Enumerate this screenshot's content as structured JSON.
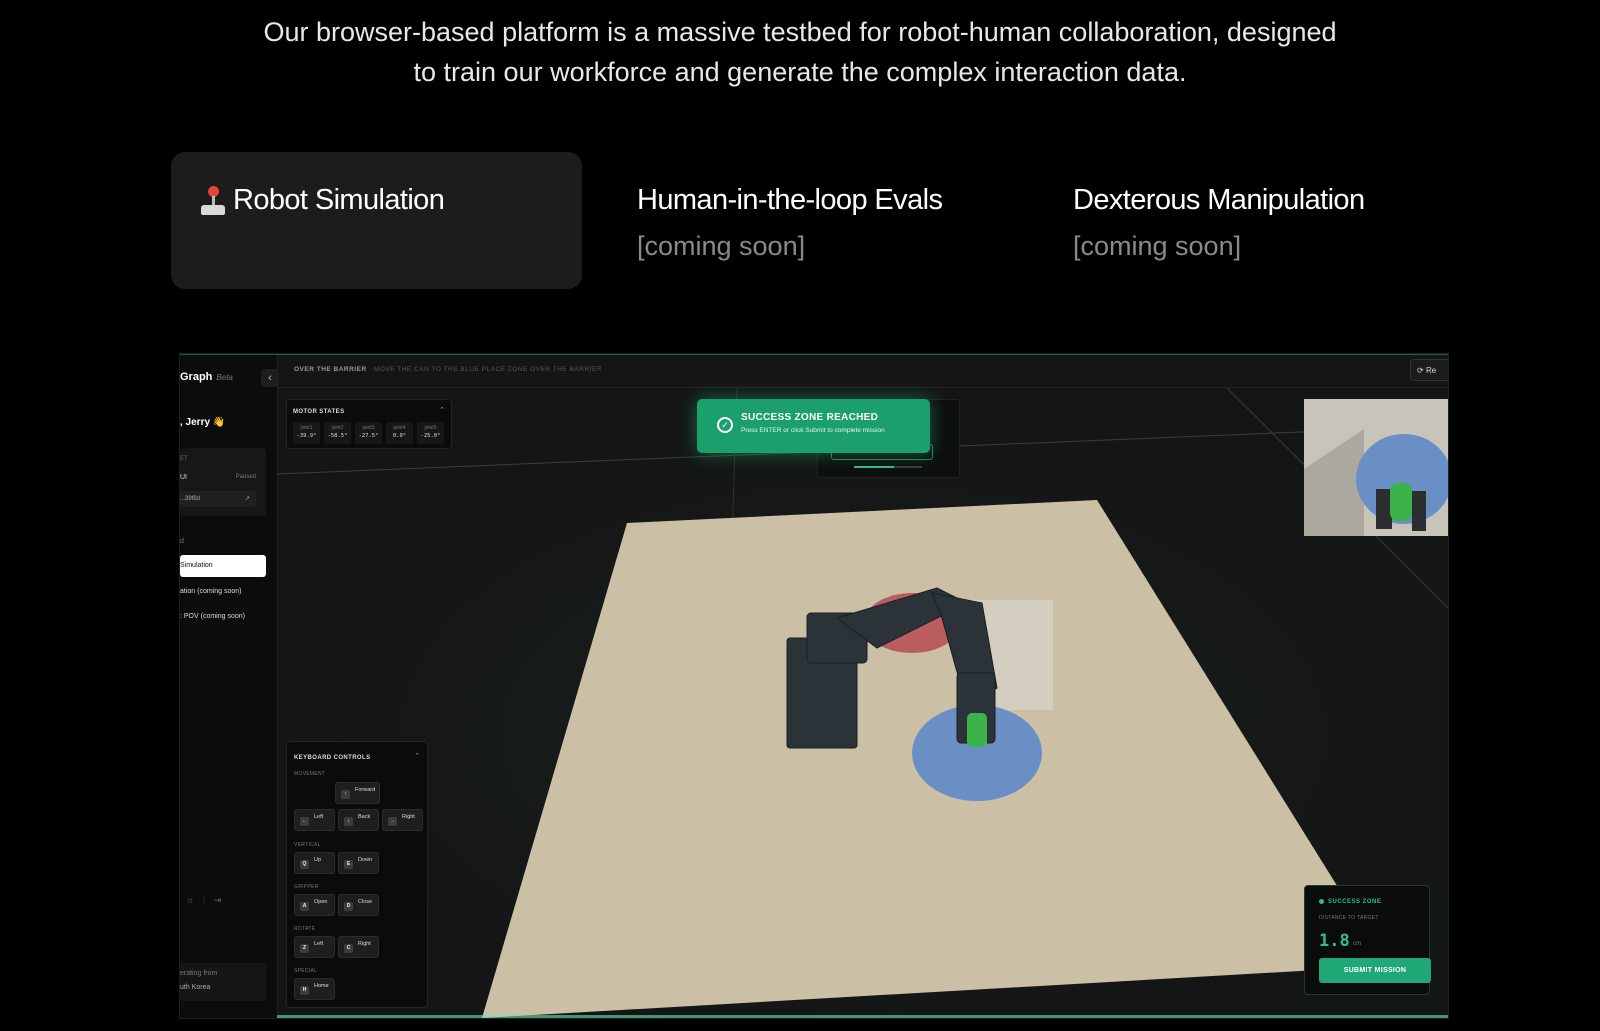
{
  "intro": {
    "line1": "Our browser-based platform is a massive testbed for robot-human collaboration, designed",
    "line2": "to train our workforce and generate the complex interaction data."
  },
  "tabs": [
    {
      "title": "Robot Simulation",
      "icon": "joystick-icon",
      "subtitle": ""
    },
    {
      "title": "Human-in-the-loop Evals",
      "subtitle": "[coming soon]"
    },
    {
      "title": "Dexterous Manipulation",
      "subtitle": "[coming soon]"
    }
  ],
  "app": {
    "brand": "Graph",
    "brand_badge": "Beta",
    "greeting": ", Jerry 👋",
    "wallet": {
      "label": "ET",
      "name": "UI",
      "status": "Paused",
      "address": "...39f8d"
    },
    "section_label": "d",
    "nav": [
      {
        "label": "Simulation",
        "active": true
      },
      {
        "label": "ation (coming soon)",
        "active": false
      },
      {
        "label": ": POV (coming soon)",
        "active": false
      }
    ],
    "location": {
      "label": "erating from",
      "value": "uth Korea"
    },
    "mission_title": "OVER THE BARRIER",
    "mission_desc": "· MOVE THE CAN TO THE BLUE PLACE ZONE OVER THE BARRIER",
    "reset_label": "Re",
    "motor_states": {
      "title": "MOTOR STATES",
      "joints": [
        {
          "name": "joint1",
          "value": "-39.9°"
        },
        {
          "name": "joint2",
          "value": "-58.5°"
        },
        {
          "name": "joint3",
          "value": "-27.5°"
        },
        {
          "name": "joint4",
          "value": "0.0°"
        },
        {
          "name": "joint5",
          "value": "-25.0°"
        }
      ]
    },
    "toast": {
      "title": "SUCCESS ZONE REACHED",
      "subtitle": "Press ENTER or click Submit to complete mission"
    },
    "keyboard": {
      "title": "KEYBOARD CONTROLS",
      "groups": {
        "movement": "MOVEMENT",
        "vertical": "VERTICAL",
        "gripper": "GRIPPER",
        "rotate": "ROTATE",
        "special": "SPECIAL"
      },
      "keys": {
        "forward": {
          "cap": "↑",
          "label": "Forward"
        },
        "left": {
          "cap": "←",
          "label": "Left"
        },
        "back": {
          "cap": "↓",
          "label": "Back"
        },
        "right": {
          "cap": "→",
          "label": "Right"
        },
        "up": {
          "cap": "Q",
          "label": "Up"
        },
        "down": {
          "cap": "E",
          "label": "Down"
        },
        "open": {
          "cap": "A",
          "label": "Open"
        },
        "close": {
          "cap": "D",
          "label": "Close"
        },
        "rot_left": {
          "cap": "Z",
          "label": "Left"
        },
        "rot_right": {
          "cap": "C",
          "label": "Right"
        },
        "home": {
          "cap": "H",
          "label": "Home"
        }
      }
    },
    "success_zone": {
      "title": "SUCCESS ZONE",
      "distance_label": "DISTANCE TO TARGET",
      "distance_value": "1.8",
      "distance_unit": "cm",
      "submit_label": "SUBMIT MISSION"
    },
    "colors": {
      "accent": "#1fa775",
      "accent_light": "#2fbf8a",
      "table": "#cbbfa6",
      "place_zone": "#6a8fc4",
      "start_zone": "#b84a55",
      "can": "#3bb34a"
    }
  }
}
